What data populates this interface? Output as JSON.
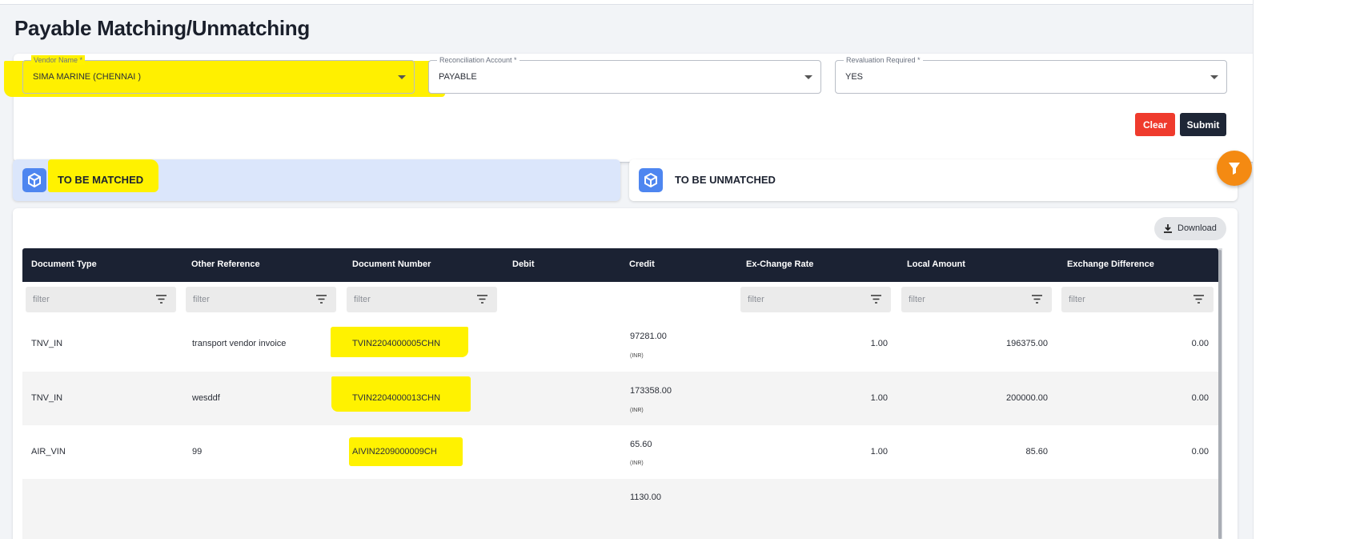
{
  "page": {
    "title": "Payable Matching/Unmatching"
  },
  "filters": {
    "vendor": {
      "label": "Vendor Name *",
      "value": "SIMA MARINE (CHENNAI )"
    },
    "reconciliation": {
      "label": "Reconciliation Account *",
      "value": "PAYABLE"
    },
    "revaluation": {
      "label": "Revaluation Required *",
      "value": "YES"
    },
    "clear_label": "Clear",
    "submit_label": "Submit"
  },
  "tabs": {
    "matched": {
      "label": "TO BE MATCHED"
    },
    "unmatched": {
      "label": "TO BE UNMATCHED"
    }
  },
  "toolbar": {
    "download_label": "Download"
  },
  "table": {
    "columns": [
      "Document Type",
      "Other Reference",
      "Document Number",
      "Debit",
      "Credit",
      "Ex-Change Rate",
      "Local Amount",
      "Exchange Difference"
    ],
    "filter_placeholder": "filter",
    "rows": [
      {
        "doc_type": "TNV_IN",
        "other_ref": "transport vendor invoice",
        "doc_number": "TVIN2204000005CHN",
        "debit": "",
        "credit": "97281.00",
        "credit_unit": "(INR)",
        "rate": "1.00",
        "local_amount": "196375.00",
        "exchange_diff": "0.00"
      },
      {
        "doc_type": "TNV_IN",
        "other_ref": "wesddf",
        "doc_number": "TVIN2204000013CHN",
        "debit": "",
        "credit": "173358.00",
        "credit_unit": "(INR)",
        "rate": "1.00",
        "local_amount": "200000.00",
        "exchange_diff": "0.00"
      },
      {
        "doc_type": "AIR_VIN",
        "other_ref": "99",
        "doc_number": "AIVIN2209000009CH",
        "debit": "",
        "credit": "65.60",
        "credit_unit": "(INR)",
        "rate": "1.00",
        "local_amount": "85.60",
        "exchange_diff": "0.00"
      },
      {
        "doc_type": "",
        "other_ref": "",
        "doc_number": "",
        "debit": "",
        "credit": "1130.00",
        "credit_unit": "",
        "rate": "",
        "local_amount": "",
        "exchange_diff": ""
      }
    ]
  },
  "colors": {
    "header_bg": "#1b2233",
    "clear": "#ef3b2d",
    "submit": "#1e2636",
    "accent_blue": "#4e86f0",
    "fab_orange": "#f48a12",
    "highlight": "#fff200"
  },
  "icons": {
    "tab": "box-icon",
    "fab": "filter-funnel-icon",
    "download": "download-icon",
    "filter": "filter-lines-icon",
    "dropdown": "caret-down-icon"
  }
}
